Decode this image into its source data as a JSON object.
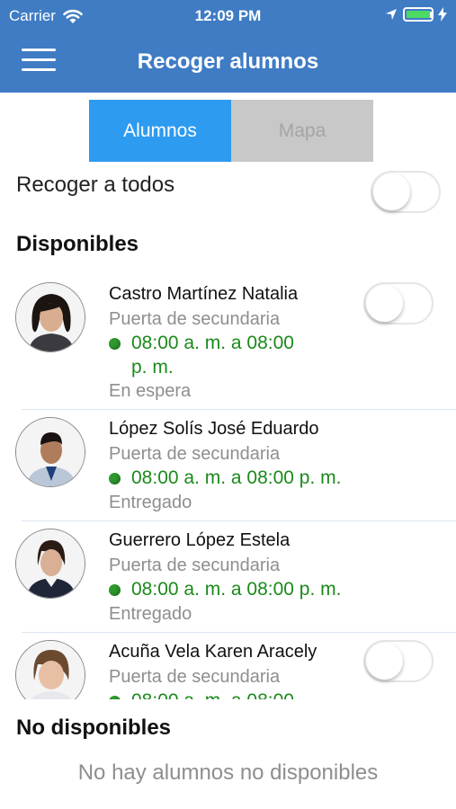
{
  "status_bar": {
    "carrier": "Carrier",
    "time": "12:09 PM"
  },
  "nav": {
    "title": "Recoger alumnos",
    "menu_icon": "hamburger-icon"
  },
  "tabs": [
    {
      "label": "Alumnos",
      "active": true
    },
    {
      "label": "Mapa",
      "active": false
    }
  ],
  "pickup_all": {
    "label": "Recoger a todos",
    "on": false
  },
  "available": {
    "heading": "Disponibles",
    "students": [
      {
        "name": "Castro Martínez Natalia",
        "door": "Puerta de secundaria",
        "time_line1": "08:00 a. m. a 08:00",
        "time_line2": "p. m.",
        "status": "En espera",
        "toggle": false
      },
      {
        "name": "López Solís José Eduardo",
        "door": "Puerta de secundaria",
        "time": "08:00 a. m. a 08:00 p. m.",
        "status": "Entregado"
      },
      {
        "name": "Guerrero López Estela",
        "door": "Puerta de secundaria",
        "time": "08:00 a. m. a 08:00 p. m.",
        "status": "Entregado"
      },
      {
        "name": "Acuña Vela Karen Aracely",
        "door": "Puerta de secundaria",
        "time": "08:00 a. m. a 08:00",
        "toggle": false
      }
    ]
  },
  "unavailable": {
    "heading": "No disponibles",
    "empty_text": "No hay alumnos no disponibles"
  },
  "colors": {
    "nav": "#3f7cc4",
    "tab_active": "#2d9bf0",
    "tab_inactive": "#c8c8c8",
    "time_green": "#1a8a1a"
  }
}
